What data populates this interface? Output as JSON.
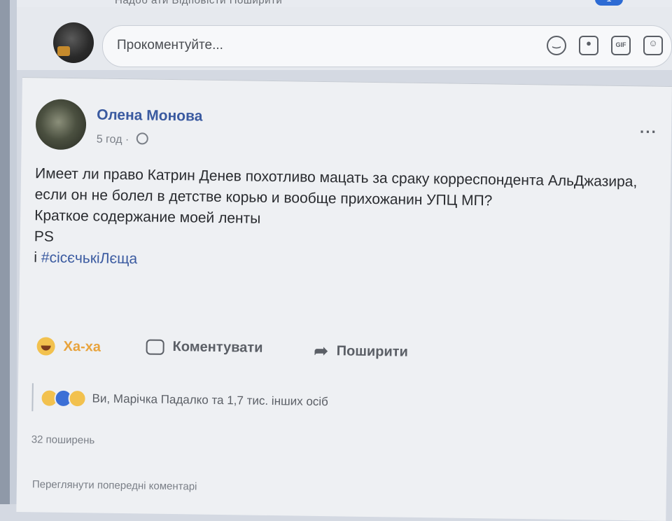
{
  "top_strip": {
    "text": "Надоб ати  Відповісти  Поширити",
    "badge": "1"
  },
  "compose": {
    "placeholder": "Прокоментуйте..."
  },
  "icons": {
    "compose": [
      "emoji-icon",
      "camera-icon",
      "gif-icon",
      "sticker-icon"
    ],
    "post": [
      "globe-icon",
      "more-icon"
    ],
    "actions": [
      "haha-icon",
      "comment-icon",
      "share-icon"
    ]
  },
  "post": {
    "author": "Олена Монова",
    "time": "5 год",
    "separator": "·",
    "more": "···",
    "body": [
      "Имеет ли право Катрин Денев похотливо мацать за сраку корреспондента АльДжазира, если он не болел в детстве корью и вообще прихожанин УПЦ МП?",
      "Краткое содержание моей ленты",
      "PS"
    ],
    "hashtag_prefix": "і ",
    "hashtag": "#сісєчькіЛєща",
    "actions": {
      "react": "Ха-ха",
      "comment": "Коментувати",
      "share": "Поширити"
    },
    "reactions_text": "Ви, Марічка Падалко та 1,7 тис. інших осіб",
    "shares": "32 поширень",
    "view_previous": "Переглянути попередні коментарі"
  },
  "colors": {
    "link": "#3a5aa0",
    "haha": "#e8a33c",
    "like": "#3b6fd6",
    "muted": "#7a7f87"
  }
}
